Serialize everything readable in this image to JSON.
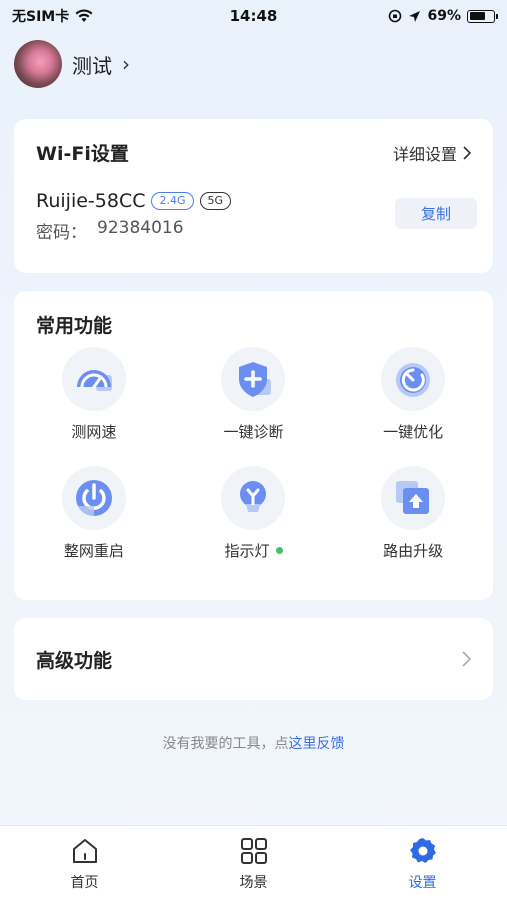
{
  "status_bar": {
    "carrier": "无SIM卡",
    "time": "14:48",
    "battery": "69%",
    "battery_level": 0.69
  },
  "profile": {
    "name": "测试"
  },
  "wifi": {
    "title": "Wi-Fi设置",
    "detail_label": "详细设置",
    "ssid": "Ruijie-58CC",
    "band_24": "2.4G",
    "band_5": "5G",
    "password_label": "密码：",
    "password_value": "92384016",
    "copy_label": "复制"
  },
  "functions": {
    "title": "常用功能",
    "items": [
      {
        "label": "测网速",
        "icon": "speedometer-icon"
      },
      {
        "label": "一键诊断",
        "icon": "shield-plus-icon"
      },
      {
        "label": "一键优化",
        "icon": "optimize-icon"
      },
      {
        "label": "整网重启",
        "icon": "power-icon"
      },
      {
        "label": "指示灯",
        "icon": "lightbulb-icon",
        "status": "on"
      },
      {
        "label": "路由升级",
        "icon": "upgrade-icon"
      }
    ]
  },
  "advanced": {
    "title": "高级功能"
  },
  "feedback": {
    "text": "没有我要的工具，点",
    "link": "这里反馈"
  },
  "tabbar": {
    "items": [
      {
        "label": "首页",
        "icon": "home-icon"
      },
      {
        "label": "场景",
        "icon": "grid-icon"
      },
      {
        "label": "设置",
        "icon": "settings-icon",
        "active": true
      }
    ]
  },
  "colors": {
    "accent": "#2f6ae6",
    "icon_blue": "#6b8ff0",
    "indicator_on": "#3cc46a"
  }
}
